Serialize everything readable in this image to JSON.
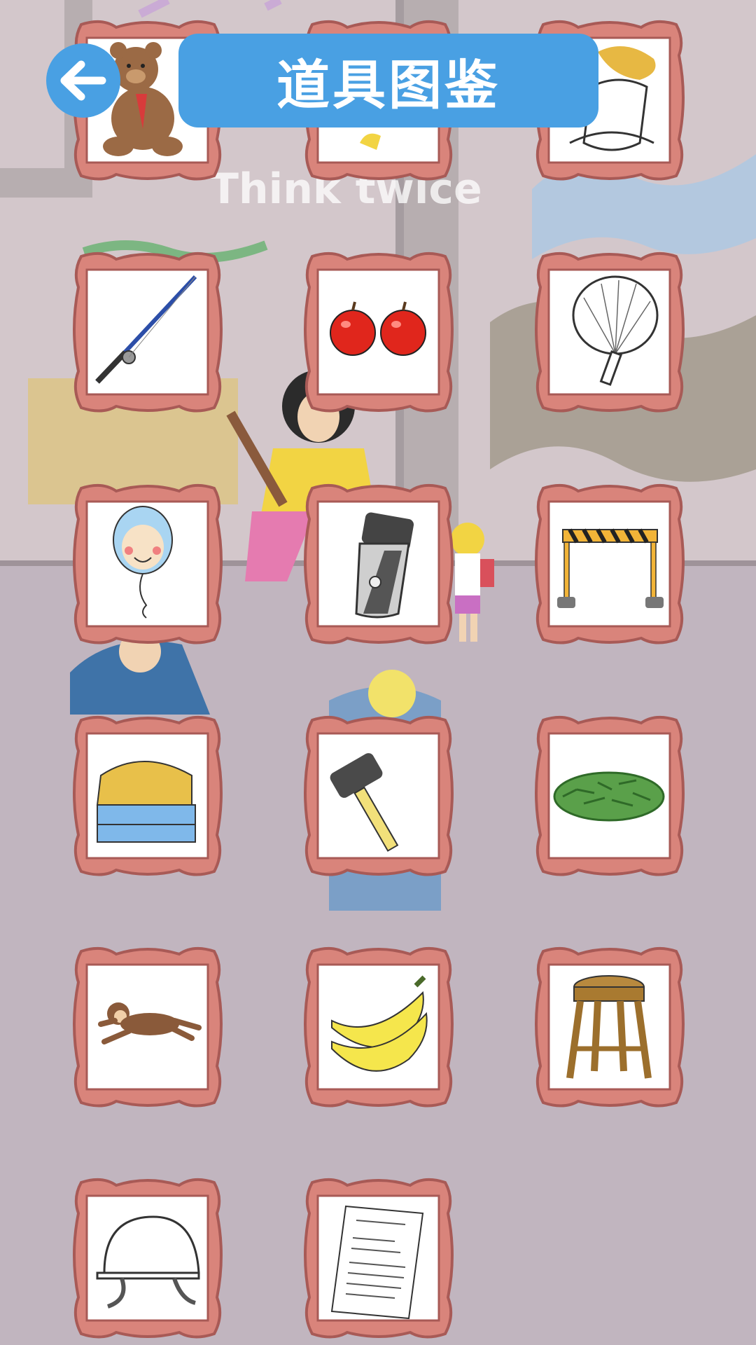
{
  "header": {
    "title": "道具图鉴",
    "back_icon": "arrow-left-icon"
  },
  "background": {
    "graffiti_text": "Think twice"
  },
  "colors": {
    "title_bar": "#49a0e3",
    "frame": "#d9847b",
    "frame_border": "#a85a56",
    "background": "#c2b6c0"
  },
  "items": [
    {
      "id": "teddy-bear",
      "icon": "teddy-bear-icon"
    },
    {
      "id": "hidden-item",
      "icon": "unknown-item-icon"
    },
    {
      "id": "cloth-bundle",
      "icon": "cloth-bundle-icon"
    },
    {
      "id": "fishing-rod",
      "icon": "fishing-rod-icon"
    },
    {
      "id": "apples",
      "icon": "apples-icon"
    },
    {
      "id": "hand-fan",
      "icon": "hand-fan-icon"
    },
    {
      "id": "face-balloon",
      "icon": "face-balloon-icon"
    },
    {
      "id": "electric-shaver",
      "icon": "electric-shaver-icon"
    },
    {
      "id": "road-barrier",
      "icon": "road-barrier-icon"
    },
    {
      "id": "folded-towels",
      "icon": "folded-towels-icon"
    },
    {
      "id": "hammer",
      "icon": "hammer-icon"
    },
    {
      "id": "grass-pile",
      "icon": "grass-pile-icon"
    },
    {
      "id": "monkey",
      "icon": "monkey-icon"
    },
    {
      "id": "bananas",
      "icon": "bananas-icon"
    },
    {
      "id": "wooden-stool",
      "icon": "wooden-stool-icon"
    },
    {
      "id": "helmet",
      "icon": "helmet-icon"
    },
    {
      "id": "document",
      "icon": "document-icon"
    }
  ]
}
